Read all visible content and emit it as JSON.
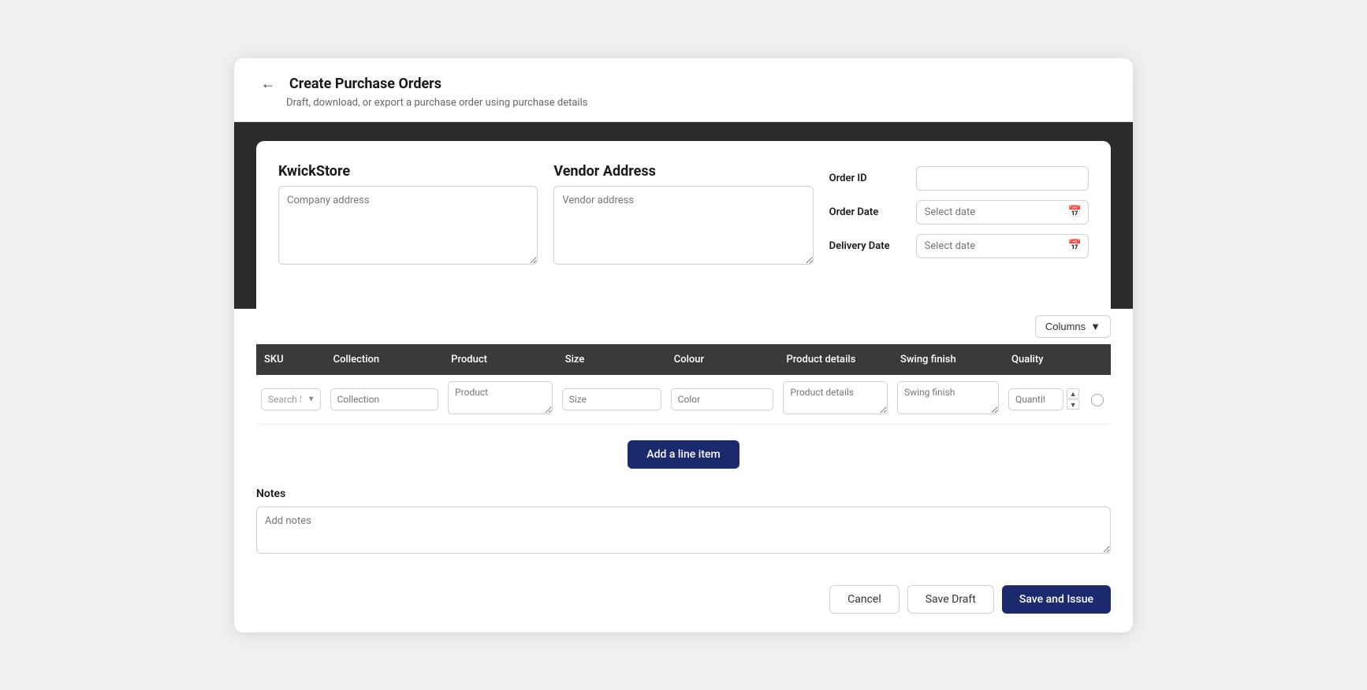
{
  "page": {
    "title": "Create Purchase Orders",
    "subtitle": "Draft, download, or export a purchase order using purchase details",
    "back_label": "←"
  },
  "company": {
    "name": "KwickStore",
    "address_placeholder": "Company address"
  },
  "vendor": {
    "title": "Vendor Address",
    "address_placeholder": "Vendor address"
  },
  "order_form": {
    "order_id_label": "Order ID",
    "order_date_label": "Order Date",
    "order_date_placeholder": "Select date",
    "delivery_date_label": "Delivery Date",
    "delivery_date_placeholder": "Select date"
  },
  "columns_btn": "Columns",
  "table": {
    "headers": [
      "SKU",
      "Collection",
      "Product",
      "Size",
      "Colour",
      "Product details",
      "Swing finish",
      "Quality"
    ],
    "row": {
      "sku_placeholder": "Search SKU",
      "collection_placeholder": "Collection",
      "product_placeholder": "Product",
      "size_placeholder": "Size",
      "color_placeholder": "Color",
      "product_details_placeholder": "Product details",
      "swing_finish_placeholder": "Swing finish",
      "quantity_placeholder": "Quantity"
    }
  },
  "add_line_btn": "Add a line item",
  "notes": {
    "label": "Notes",
    "placeholder": "Add notes"
  },
  "footer": {
    "cancel_label": "Cancel",
    "save_draft_label": "Save Draft",
    "save_issue_label": "Save and Issue"
  }
}
